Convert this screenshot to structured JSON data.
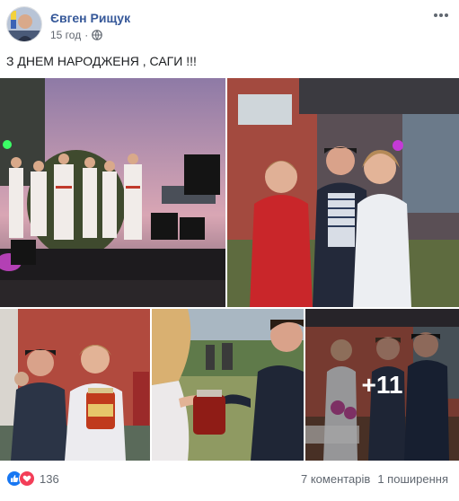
{
  "post": {
    "author": "Євген Рищук",
    "time": "15 год",
    "privacy_icon": "globe-icon",
    "text": "З ДНЕМ НАРОДЖЕНЯ , САГИ !!!"
  },
  "photos": {
    "more_count": "+11"
  },
  "footer": {
    "reaction_icons": [
      "like-icon",
      "love-icon"
    ],
    "reaction_count": "136",
    "comments": "7 коментарів",
    "shares": "1 поширення"
  },
  "colors": {
    "link": "#365899",
    "like": "#1877f2",
    "love": "#f33e58"
  }
}
